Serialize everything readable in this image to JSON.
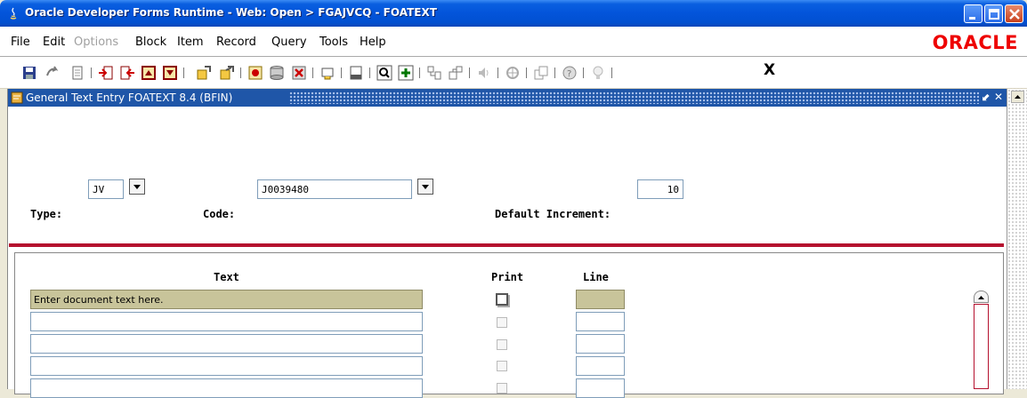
{
  "window": {
    "title": "Oracle Developer Forms Runtime - Web:  Open > FGAJVCQ - FOATEXT"
  },
  "menubar": {
    "items": [
      {
        "label": "File",
        "enabled": true
      },
      {
        "label": "Edit",
        "enabled": true
      },
      {
        "label": "Options",
        "enabled": false
      },
      {
        "label": "Block",
        "enabled": true
      },
      {
        "label": "Item",
        "enabled": true
      },
      {
        "label": "Record",
        "enabled": true
      },
      {
        "label": "Query",
        "enabled": true
      },
      {
        "label": "Tools",
        "enabled": true
      },
      {
        "label": "Help",
        "enabled": true
      }
    ],
    "logo": "ORACLE"
  },
  "toolbar": {
    "icons": [
      "save-icon",
      "rollback-icon",
      "print-icon",
      "next-block-icon",
      "previous-block-icon",
      "next-record-icon",
      "previous-record-icon",
      "enter-query-icon",
      "execute-query-icon",
      "insert-record-icon",
      "remove-record-icon",
      "clear-record-icon",
      "lookup-icon",
      "print-screen-icon",
      "search-icon",
      "add-icon",
      "options-icon",
      "tree-icon",
      "audio-icon",
      "help-wheel-icon",
      "copy-icon",
      "help-icon",
      "tip-icon"
    ],
    "exit_label": "X"
  },
  "form": {
    "title": "General Text Entry  FOATEXT  8.4  (BFIN)",
    "type_label": "Type:",
    "type_value": "JV",
    "code_label": "Code:",
    "code_value": "J0039480",
    "increment_label": "Default Increment:",
    "increment_value": "10"
  },
  "grid": {
    "headers": {
      "text": "Text",
      "print": "Print",
      "line": "Line"
    },
    "rows": [
      {
        "text": "Enter document text here.",
        "print": false,
        "line": "",
        "active": true
      },
      {
        "text": "",
        "print": false,
        "line": "",
        "active": false
      },
      {
        "text": "",
        "print": false,
        "line": "",
        "active": false
      },
      {
        "text": "",
        "print": false,
        "line": "",
        "active": false
      },
      {
        "text": "",
        "print": false,
        "line": "",
        "active": false
      }
    ]
  }
}
